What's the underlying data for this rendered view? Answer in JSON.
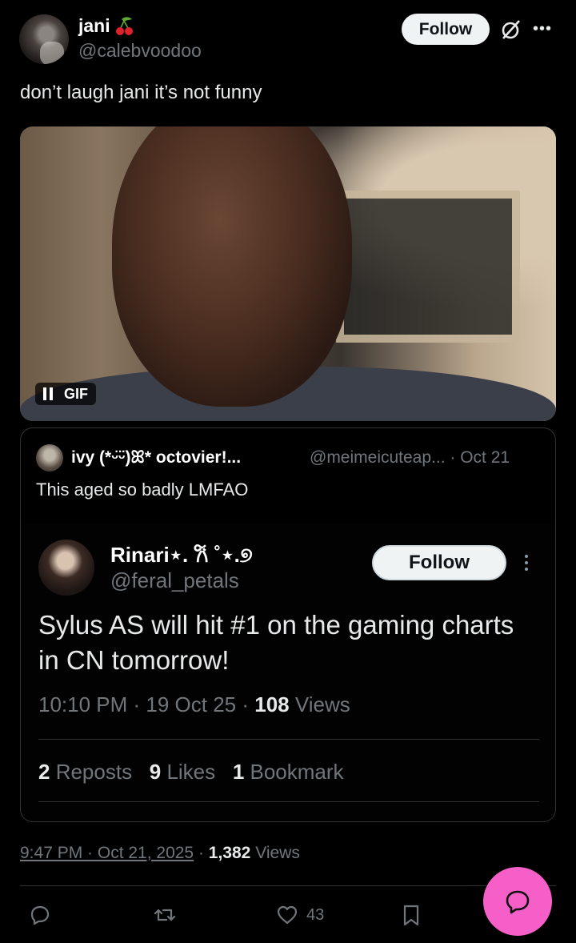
{
  "author": {
    "name": "jani",
    "handle": "@calebvoodoo",
    "follow_label": "Follow"
  },
  "tweet": {
    "text": "don’t laugh jani it’s not funny",
    "media_badge": "GIF"
  },
  "quote": {
    "name": "ivy (*ᵕ̈ᵕ̈)ꕤ* octovier!...",
    "handle_date": "@meimeicuteap... · Oct 21",
    "text": "This aged so badly LMFAO",
    "screenshot": {
      "name": "Rinari⋆. 𐙚 ˚⋆.୭",
      "handle": "@feral_petals",
      "follow_label": "Follow",
      "text": "Sylus AS will hit #1 on the gaming charts in CN tomorrow!",
      "time": "10:10 PM · 19 Oct 25 · ",
      "views_count": "108",
      "views_label": " Views",
      "reposts_count": "2",
      "reposts_label": " Reposts",
      "likes_count": "9",
      "likes_label": " Likes",
      "bookmarks_count": "1",
      "bookmarks_label": " Bookmark"
    }
  },
  "meta": {
    "timestamp": "9:47 PM · Oct 21, 2025",
    "separator": " · ",
    "views_count": "1,382",
    "views_label": " Views"
  },
  "actions": {
    "reply_icon": "reply-icon",
    "repost_icon": "repost-icon",
    "like_icon": "heart-icon",
    "like_count": "43",
    "bookmark_icon": "bookmark-icon",
    "fab_icon": "grok-chat-icon"
  },
  "colors": {
    "background": "#000000",
    "text": "#e7e9ea",
    "secondary": "#71767b",
    "fab": "#f75fc8"
  }
}
